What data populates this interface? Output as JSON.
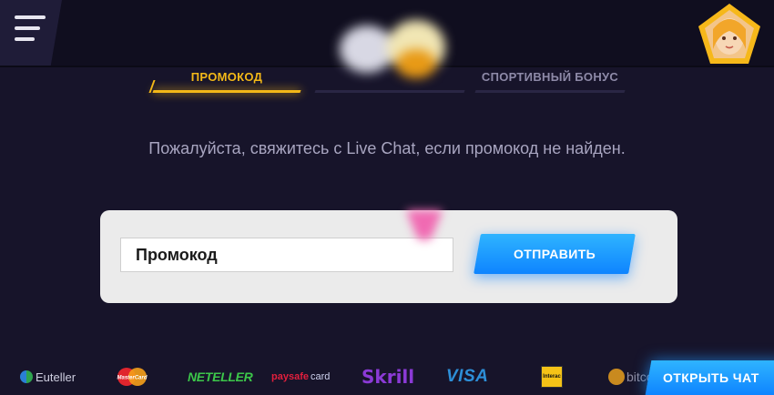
{
  "header": {
    "menu_icon": "hamburger-menu-icon",
    "avatar_icon": "user-avatar-icon"
  },
  "tabs": [
    {
      "label": "ПРОМОКОД",
      "active": true
    },
    {
      "label": "",
      "active": false
    },
    {
      "label": "СПОРТИВНЫЙ БОНУС",
      "active": false
    }
  ],
  "main": {
    "info_text": "Пожалуйста, свяжитесь с Live Chat, если промокод не найден."
  },
  "promo": {
    "input_placeholder": "Промокод",
    "submit_label": "ОТПРАВИТЬ"
  },
  "payments": {
    "euteller": "Euteller",
    "mastercard": "MasterCard",
    "neteller": "NETELLER",
    "paysafe_prefix": "paysafe",
    "paysafe_suffix": "card",
    "skrill": "Skrill",
    "visa": "VISA",
    "interac": "Interac",
    "bitcoin": "bitcoin"
  },
  "chat": {
    "button_label": "ОТКРЫТЬ ЧАТ"
  },
  "colors": {
    "accent": "#f3b818",
    "button_blue": "#1d9bff",
    "background": "#17142a"
  }
}
